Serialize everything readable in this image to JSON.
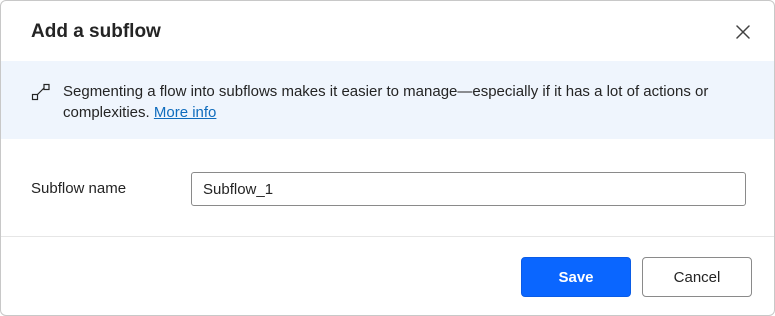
{
  "dialog": {
    "title": "Add a subflow",
    "close_icon": "close-icon"
  },
  "info": {
    "icon": "subflow-icon",
    "text": "Segmenting a flow into subflows makes it easier to manage—especially if it has a lot of actions or complexities.",
    "link_text": "More info"
  },
  "form": {
    "name_label": "Subflow name",
    "name_value": "Subflow_1"
  },
  "actions": {
    "save_label": "Save",
    "cancel_label": "Cancel"
  },
  "colors": {
    "primary": "#0a66ff",
    "info_background": "#eff5fd",
    "link": "#0f6cbd"
  }
}
